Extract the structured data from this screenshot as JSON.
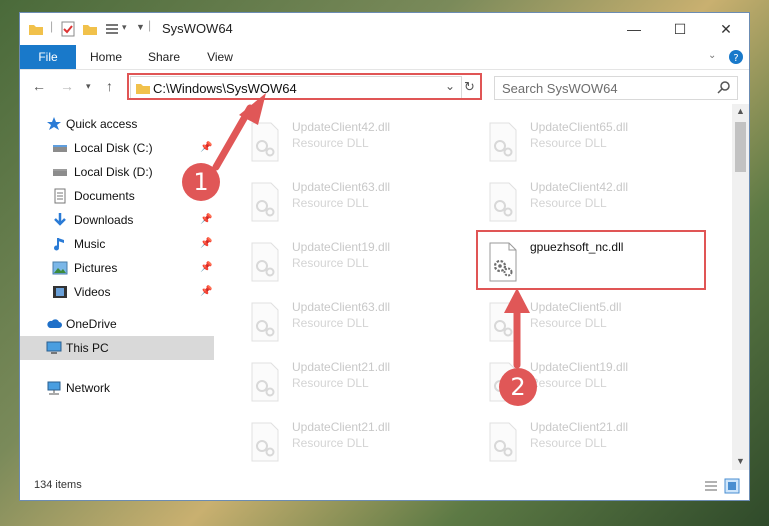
{
  "window": {
    "title": "SysWOW64",
    "minimize": "—",
    "maximize": "☐",
    "close": "✕"
  },
  "ribbon": {
    "tabs": [
      "File",
      "Home",
      "Share",
      "View"
    ]
  },
  "address": {
    "path": "C:\\Windows\\SysWOW64"
  },
  "search": {
    "placeholder": "Search SysWOW64"
  },
  "sidebar": {
    "items": [
      {
        "label": "Quick access",
        "icon": "star-icon"
      },
      {
        "label": "Local Disk (C:)",
        "icon": "drive-icon",
        "pinned": true
      },
      {
        "label": "Local Disk (D:)",
        "icon": "drive-icon",
        "pinned": false
      },
      {
        "label": "Documents",
        "icon": "documents-icon",
        "pinned": true
      },
      {
        "label": "Downloads",
        "icon": "download-icon",
        "pinned": true
      },
      {
        "label": "Music",
        "icon": "music-icon",
        "pinned": true
      },
      {
        "label": "Pictures",
        "icon": "pictures-icon",
        "pinned": true
      },
      {
        "label": "Videos",
        "icon": "videos-icon",
        "pinned": true
      },
      {
        "label": "OneDrive",
        "icon": "cloud-icon"
      },
      {
        "label": "This PC",
        "icon": "computer-icon",
        "selected": true
      },
      {
        "label": "Network",
        "icon": "network-icon"
      }
    ]
  },
  "files": {
    "left": [
      {
        "name": "UpdateClient42.dll",
        "type": "Resource DLL"
      },
      {
        "name": "UpdateClient63.dll",
        "type": "Resource DLL"
      },
      {
        "name": "UpdateClient19.dll",
        "type": "Resource DLL"
      },
      {
        "name": "UpdateClient63.dll",
        "type": "Resource DLL"
      },
      {
        "name": "UpdateClient21.dll",
        "type": "Resource DLL"
      },
      {
        "name": "UpdateClient21.dll",
        "type": "Resource DLL"
      }
    ],
    "right": [
      {
        "name": "UpdateClient65.dll",
        "type": "Resource DLL"
      },
      {
        "name": "UpdateClient42.dll",
        "type": "Resource DLL"
      },
      {
        "name": "gpuezhsoft_nc.dll",
        "type": "",
        "highlighted": true
      },
      {
        "name": "UpdateClient5.dll",
        "type": "Resource DLL"
      },
      {
        "name": "UpdateClient19.dll",
        "type": "Resource DLL"
      },
      {
        "name": "UpdateClient21.dll",
        "type": "Resource DLL"
      }
    ]
  },
  "status": {
    "count": "134 items"
  },
  "annotations": {
    "badge1": "1",
    "badge2": "2",
    "color": "#e05757"
  }
}
